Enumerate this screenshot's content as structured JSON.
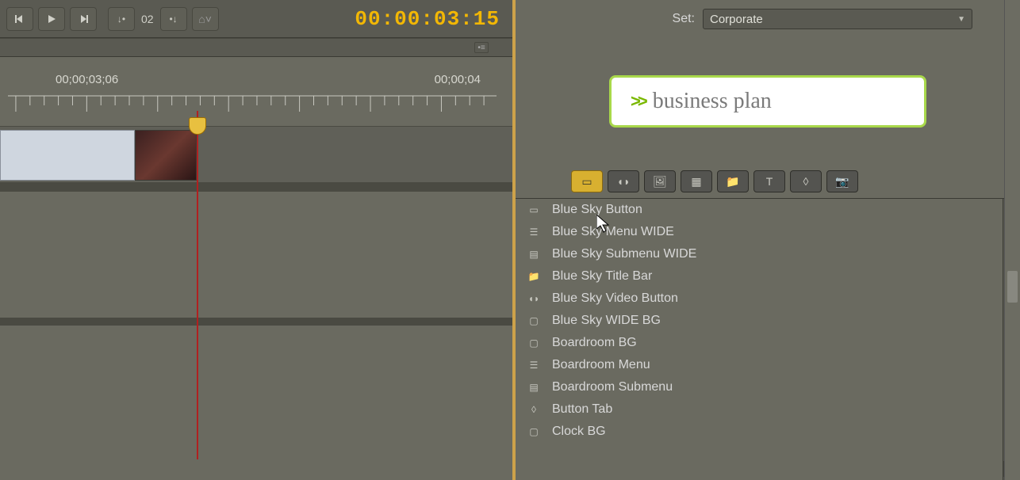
{
  "toolbar": {
    "frame_number": "02",
    "timecode": "00:00:03:15"
  },
  "ruler": {
    "label_left": "00;00;03;06",
    "label_right": "00;00;04"
  },
  "library": {
    "set_label": "Set:",
    "set_value": "Corporate",
    "preview_text": "business plan",
    "items": [
      {
        "icon": "button",
        "label": "Blue Sky Button"
      },
      {
        "icon": "menu",
        "label": "Blue Sky Menu WIDE"
      },
      {
        "icon": "submenu",
        "label": "Blue Sky Submenu WIDE"
      },
      {
        "icon": "folder",
        "label": "Blue Sky Title Bar"
      },
      {
        "icon": "video",
        "label": "Blue Sky Video Button"
      },
      {
        "icon": "bg",
        "label": "Blue Sky WIDE BG"
      },
      {
        "icon": "bg",
        "label": "Boardroom BG"
      },
      {
        "icon": "menu",
        "label": "Boardroom Menu"
      },
      {
        "icon": "submenu",
        "label": "Boardroom Submenu"
      },
      {
        "icon": "tab",
        "label": "Button Tab"
      },
      {
        "icon": "bg",
        "label": "Clock BG"
      }
    ]
  }
}
